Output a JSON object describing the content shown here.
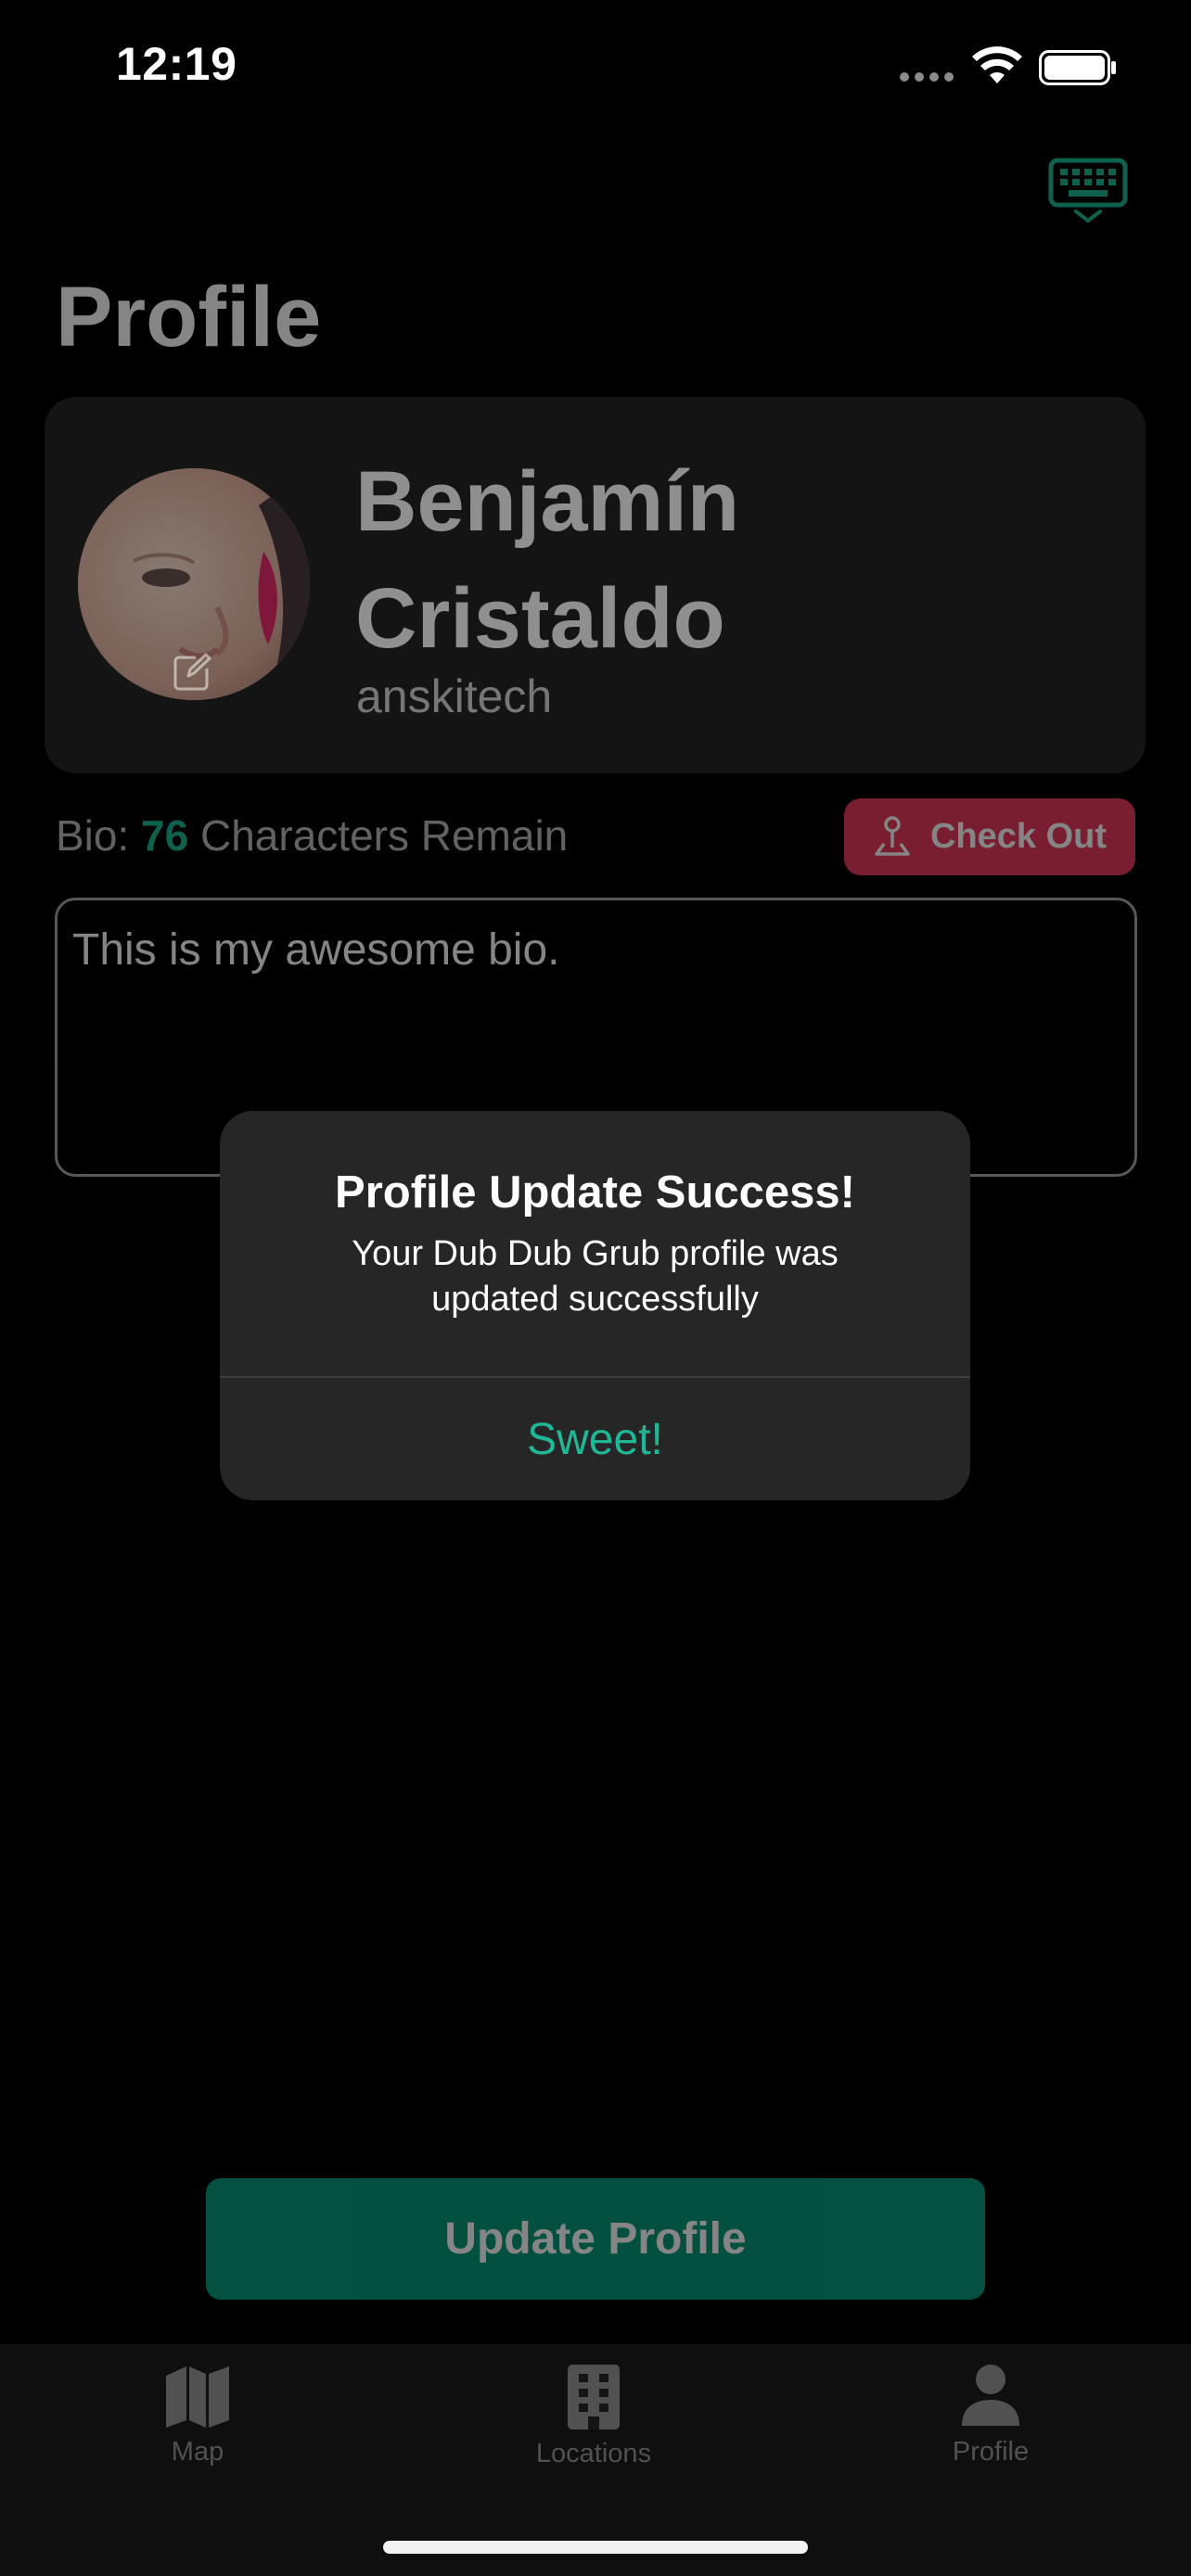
{
  "status_bar": {
    "time": "12:19",
    "icons": [
      "cellular-dots-icon",
      "wifi-icon",
      "battery-icon"
    ]
  },
  "toolbar": {
    "keyboard_icon": "keyboard-dismiss-icon",
    "accent_color": "#1fb896"
  },
  "page": {
    "title": "Profile"
  },
  "profile": {
    "first_name": "Benjamín",
    "last_name": "Cristaldo",
    "username": "anskitech",
    "avatar_edit_icon": "square-pencil-icon"
  },
  "bio": {
    "label_prefix": "Bio: ",
    "remaining_count": "76",
    "label_suffix": " Characters Remain",
    "text": "This is my awesome bio."
  },
  "checkout": {
    "label": "Check Out",
    "icon": "map-pin-icon",
    "color": "#e8395e"
  },
  "update_button": {
    "label": "Update Profile",
    "color": "#079a7d"
  },
  "alert": {
    "title": "Profile Update Success!",
    "message": "Your Dub Dub Grub profile was updated successfully",
    "button_label": "Sweet!"
  },
  "tabs": [
    {
      "label": "Map",
      "icon": "map-icon"
    },
    {
      "label": "Locations",
      "icon": "building-icon"
    },
    {
      "label": "Profile",
      "icon": "person-icon",
      "selected": true
    }
  ]
}
